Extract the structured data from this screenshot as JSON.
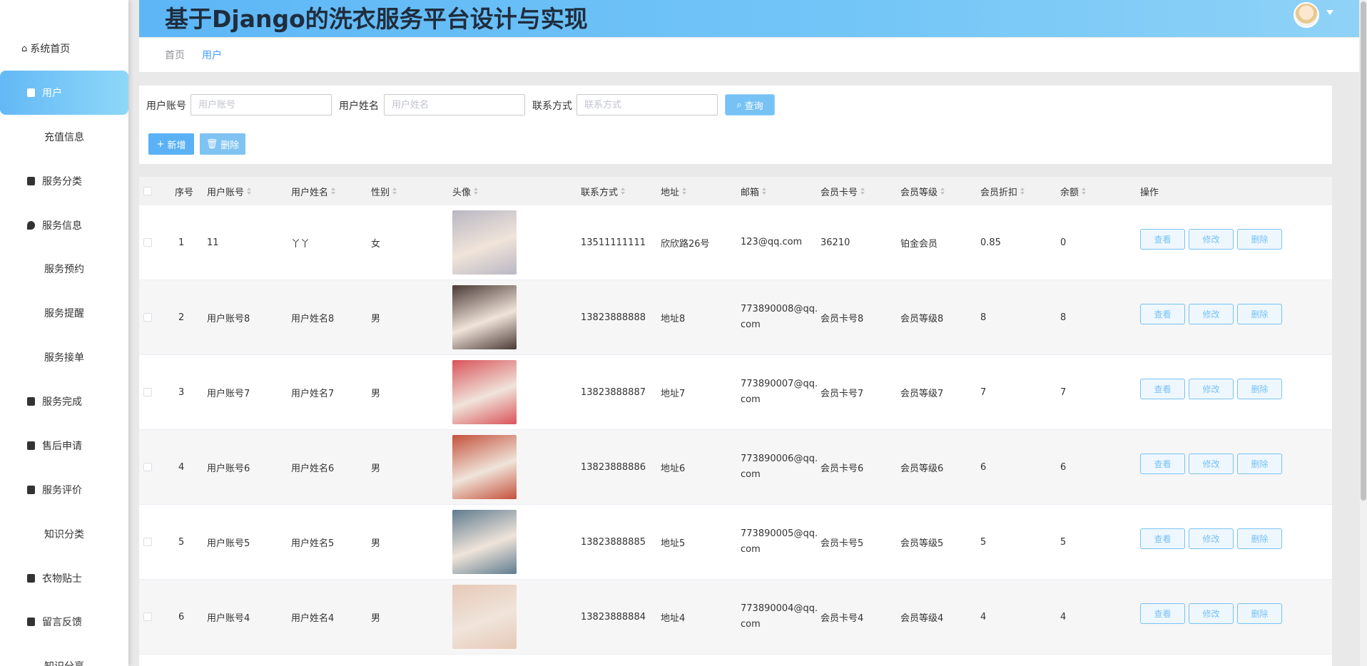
{
  "app": {
    "title": "基于Django的洗衣服务平台设计与实现"
  },
  "sidebar": {
    "home": "系统首页",
    "items": [
      {
        "label": "用户",
        "icon": "briefcase-icon",
        "active": true
      },
      {
        "label": "充值信息",
        "icon": "grid-icon"
      },
      {
        "label": "服务分类",
        "icon": "clipboard-icon"
      },
      {
        "label": "服务信息",
        "icon": "pin-icon"
      },
      {
        "label": "服务预约",
        "icon": "grid-icon"
      },
      {
        "label": "服务提醒",
        "icon": "grid-icon"
      },
      {
        "label": "服务接单",
        "icon": "grid-icon"
      },
      {
        "label": "服务完成",
        "icon": "calendar-x-icon"
      },
      {
        "label": "售后申请",
        "icon": "thumb-icon"
      },
      {
        "label": "服务评价",
        "icon": "calendar-check-icon"
      },
      {
        "label": "知识分类",
        "icon": "grid-icon"
      },
      {
        "label": "衣物贴士",
        "icon": "monitor-icon"
      },
      {
        "label": "留言反馈",
        "icon": "send-icon"
      },
      {
        "label": "知识分享",
        "icon": "grid-icon"
      }
    ]
  },
  "breadcrumb": {
    "home": "首页",
    "current": "用户"
  },
  "search": {
    "account_label": "用户账号",
    "account_placeholder": "用户账号",
    "name_label": "用户姓名",
    "name_placeholder": "用户姓名",
    "contact_label": "联系方式",
    "contact_placeholder": "联系方式",
    "query": "查询"
  },
  "actions": {
    "add": "新增",
    "delete": "删除"
  },
  "table": {
    "headers": [
      "序号",
      "用户账号",
      "用户姓名",
      "性别",
      "头像",
      "联系方式",
      "地址",
      "邮箱",
      "会员卡号",
      "会员等级",
      "会员折扣",
      "余额",
      "操作"
    ],
    "rows": [
      {
        "no": "1",
        "account": "11",
        "name": "丫丫",
        "gender": "女",
        "phone": "13511111111",
        "address": "欣欣路26号",
        "email": "123@qq.com",
        "card": "36210",
        "level": "铂金会员",
        "discount": "0.85",
        "balance": "0",
        "avatar_color": "#b9b7c3"
      },
      {
        "no": "2",
        "account": "用户账号8",
        "name": "用户姓名8",
        "gender": "男",
        "phone": "13823888888",
        "address": "地址8",
        "email": "773890008@qq.com",
        "card": "会员卡号8",
        "level": "会员等级8",
        "discount": "8",
        "balance": "8",
        "avatar_color": "#4a3a36"
      },
      {
        "no": "3",
        "account": "用户账号7",
        "name": "用户姓名7",
        "gender": "男",
        "phone": "13823888887",
        "address": "地址7",
        "email": "773890007@qq.com",
        "card": "会员卡号7",
        "level": "会员等级7",
        "discount": "7",
        "balance": "7",
        "avatar_color": "#d9535a"
      },
      {
        "no": "4",
        "account": "用户账号6",
        "name": "用户姓名6",
        "gender": "男",
        "phone": "13823888886",
        "address": "地址6",
        "email": "773890006@qq.com",
        "card": "会员卡号6",
        "level": "会员等级6",
        "discount": "6",
        "balance": "6",
        "avatar_color": "#c4523c"
      },
      {
        "no": "5",
        "account": "用户账号5",
        "name": "用户姓名5",
        "gender": "男",
        "phone": "13823888885",
        "address": "地址5",
        "email": "773890005@qq.com",
        "card": "会员卡号5",
        "level": "会员等级5",
        "discount": "5",
        "balance": "5",
        "avatar_color": "#5f7c8f"
      },
      {
        "no": "6",
        "account": "用户账号4",
        "name": "用户姓名4",
        "gender": "男",
        "phone": "13823888884",
        "address": "地址4",
        "email": "773890004@qq.com",
        "card": "会员卡号4",
        "level": "会员等级4",
        "discount": "4",
        "balance": "4",
        "avatar_color": "#e6c9b8"
      }
    ],
    "row_actions": {
      "view": "查看",
      "edit": "修改",
      "delete": "删除"
    }
  },
  "colors": {
    "accent": "#409eff",
    "header_gradient_start": "#5db6f6",
    "button_blue": "#77c2f5"
  }
}
